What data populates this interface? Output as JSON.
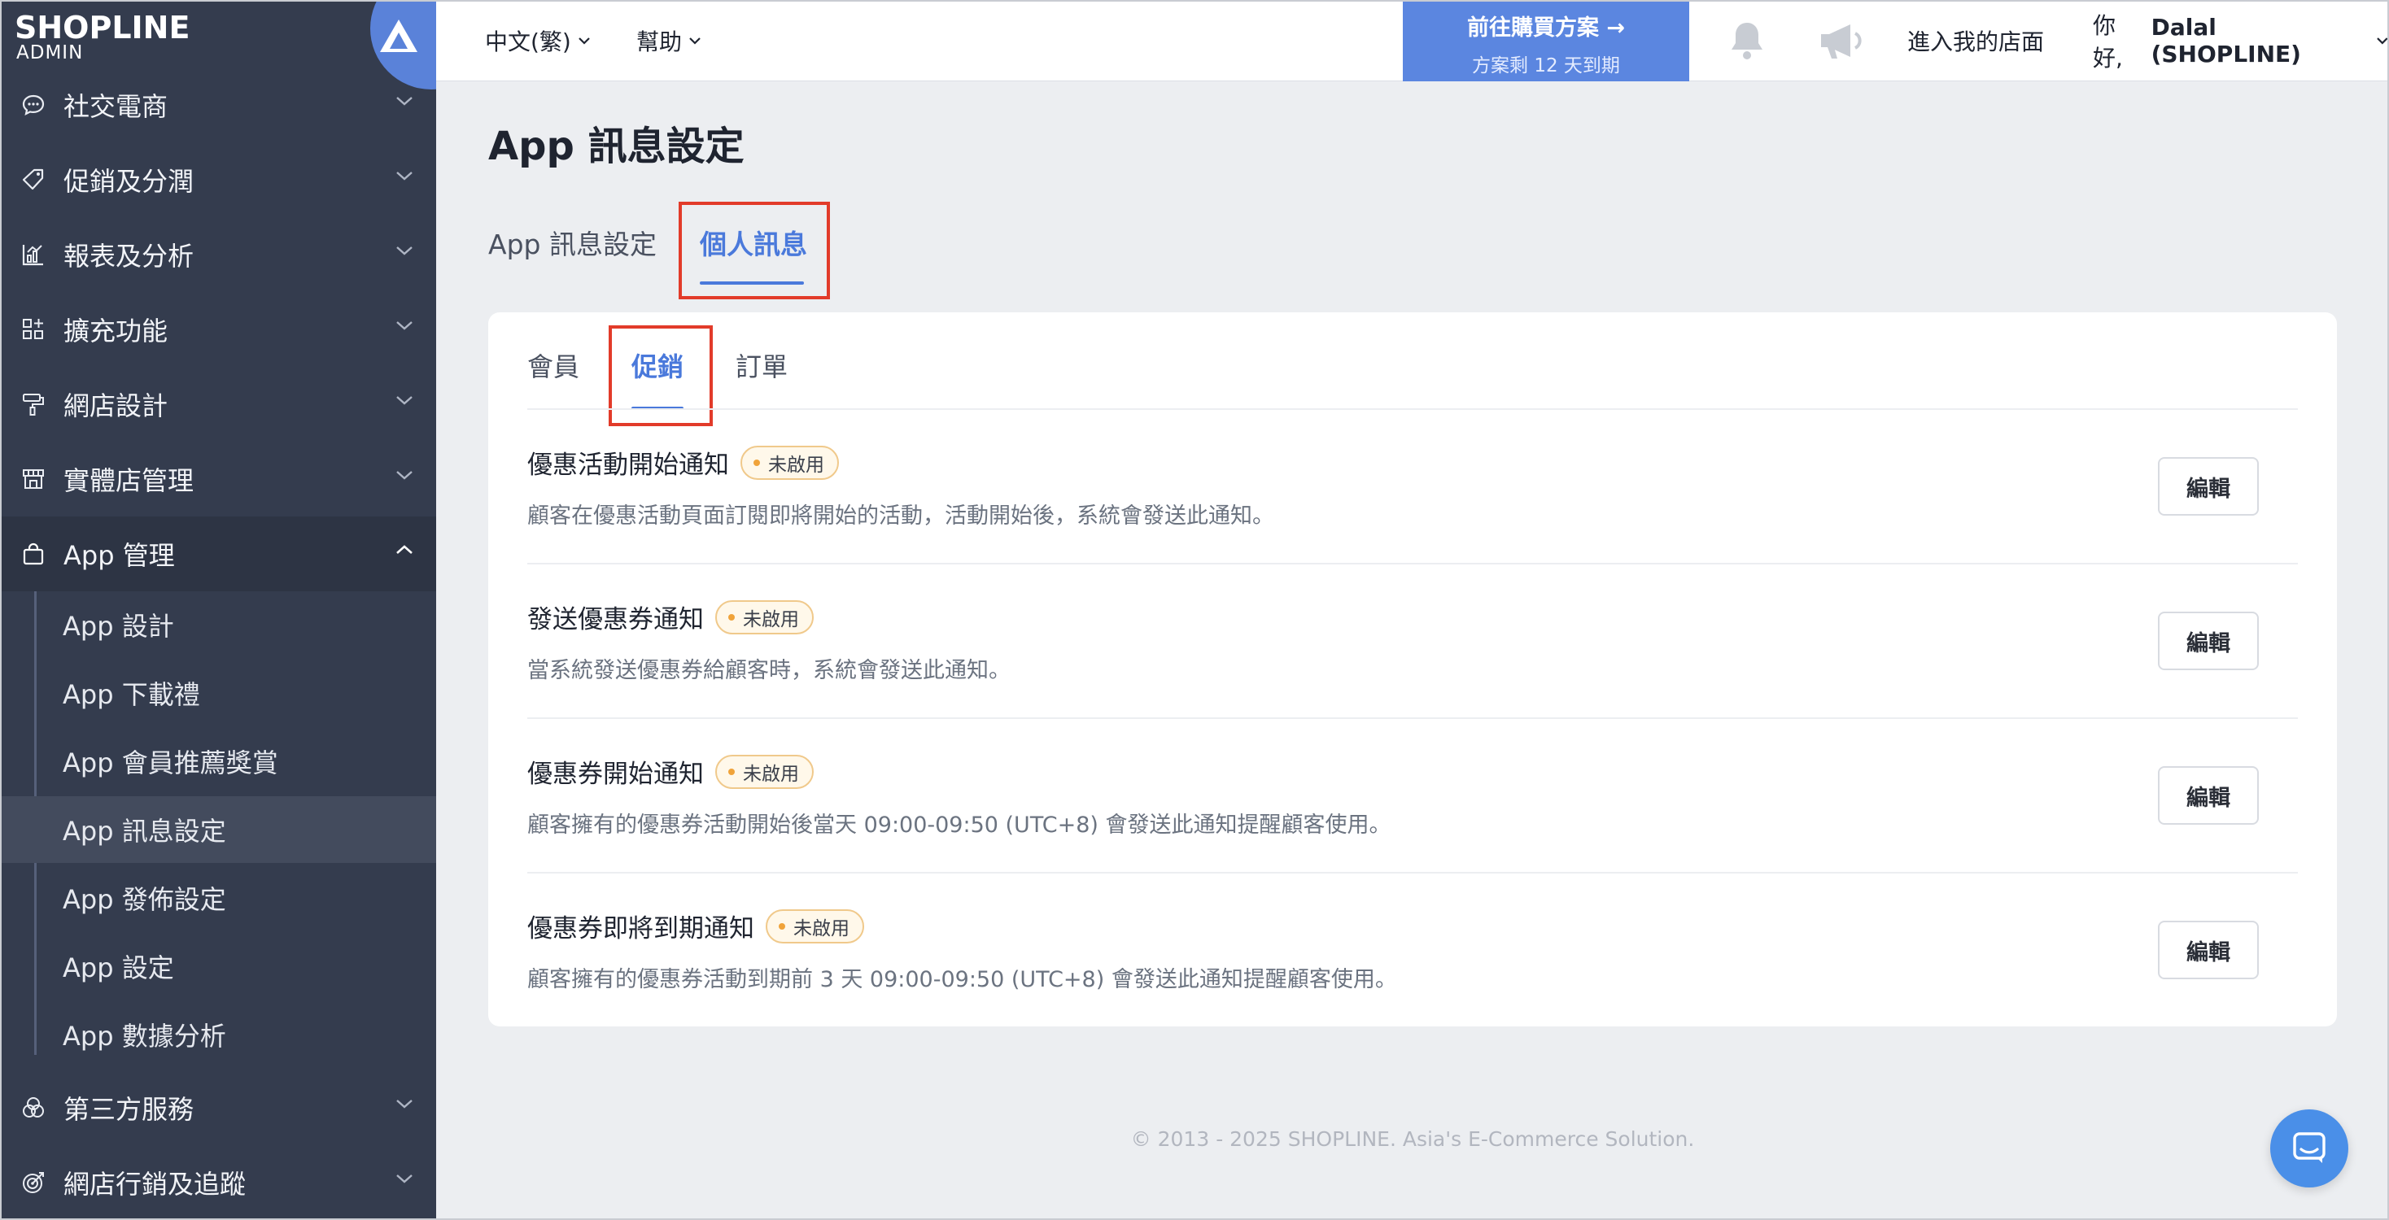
{
  "brand": {
    "name": "SHOPLINE",
    "sub": "ADMIN"
  },
  "sidebar": {
    "items": [
      {
        "label": "社交電商",
        "icon": "chat-bubble-icon"
      },
      {
        "label": "促銷及分潤",
        "icon": "tag-icon"
      },
      {
        "label": "報表及分析",
        "icon": "bar-chart-icon"
      },
      {
        "label": "擴充功能",
        "icon": "apps-grid-icon"
      },
      {
        "label": "網店設計",
        "icon": "paint-roller-icon"
      },
      {
        "label": "實體店管理",
        "icon": "store-icon"
      },
      {
        "label": "App 管理",
        "icon": "shopping-bag-icon"
      },
      {
        "label": "第三方服務",
        "icon": "circles-icon"
      },
      {
        "label": "網店行銷及追蹤",
        "icon": "target-icon"
      }
    ],
    "sub_items": [
      {
        "label": "App 設計"
      },
      {
        "label": "App 下載禮"
      },
      {
        "label": "App 會員推薦獎賞"
      },
      {
        "label": "App 訊息設定"
      },
      {
        "label": "App 發佈設定"
      },
      {
        "label": "App 設定"
      },
      {
        "label": "App 數據分析"
      }
    ]
  },
  "topbar": {
    "language": "中文(繁)",
    "help": "幫助",
    "upgrade_title": "前往購買方案 →",
    "upgrade_sub": "方案剩 12 天到期",
    "store_link": "進入我的店面",
    "greeting": "你好,",
    "user": "Dalal (SHOPLINE)"
  },
  "page": {
    "title": "App 訊息設定",
    "tabs": [
      {
        "label": "App 訊息設定"
      },
      {
        "label": "個人訊息"
      }
    ],
    "inner_tabs": [
      {
        "label": "會員"
      },
      {
        "label": "促銷"
      },
      {
        "label": "訂單"
      }
    ],
    "rows": [
      {
        "title": "優惠活動開始通知",
        "status": "未啟用",
        "desc": "顧客在優惠活動頁面訂閱即將開始的活動，活動開始後，系統會發送此通知。",
        "button": "編輯"
      },
      {
        "title": "發送優惠券通知",
        "status": "未啟用",
        "desc": "當系統發送優惠券給顧客時，系統會發送此通知。",
        "button": "編輯"
      },
      {
        "title": "優惠券開始通知",
        "status": "未啟用",
        "desc": "顧客擁有的優惠券活動開始後當天 09:00-09:50 (UTC+8) 會發送此通知提醒顧客使用。",
        "button": "編輯"
      },
      {
        "title": "優惠券即將到期通知",
        "status": "未啟用",
        "desc": "顧客擁有的優惠券活動到期前 3 天 09:00-09:50 (UTC+8) 會發送此通知提醒顧客使用。",
        "button": "編輯"
      }
    ],
    "footer": "© 2013 - 2025  SHOPLINE. Asia's E-Commerce Solution."
  },
  "colors": {
    "sidebar_bg": "#343c4e",
    "accent": "#4a79db",
    "upgrade_bg": "#5b86e0",
    "highlight": "#e23b2a",
    "badge_dot": "#f0a33a"
  }
}
